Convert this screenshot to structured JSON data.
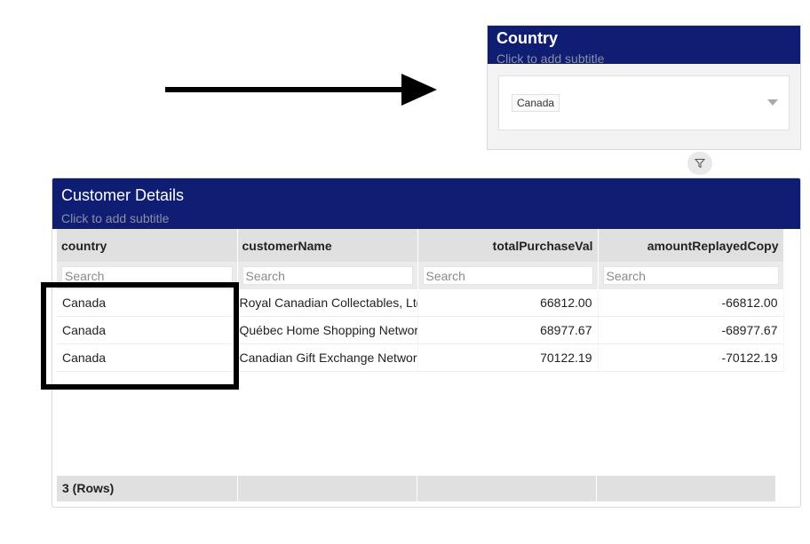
{
  "country_filter": {
    "title": "Country",
    "subtitle": "Click to add subtitle",
    "selected_value": "Canada"
  },
  "details": {
    "title": "Customer Details",
    "subtitle": "Click to add subtitle",
    "columns": [
      "country",
      "customerName",
      "totalPurchaseVal",
      "amountReplayedCopy"
    ],
    "search_placeholder": "Search",
    "rows": [
      [
        "Canada",
        "Royal Canadian Collectables, Ltd.",
        "66812.00",
        "-66812.00"
      ],
      [
        "Canada",
        "Québec Home Shopping Network",
        "68977.67",
        "-68977.67"
      ],
      [
        "Canada",
        "Canadian Gift Exchange Network",
        "70122.19",
        "-70122.19"
      ]
    ],
    "row_count": "3 (Rows)"
  },
  "icons": {
    "arrow": "right-arrow-icon",
    "filter": "funnel-icon",
    "caret": "chevron-down-icon"
  },
  "colors": {
    "header_bg": "#0f1e73",
    "annotation": "#000000"
  }
}
